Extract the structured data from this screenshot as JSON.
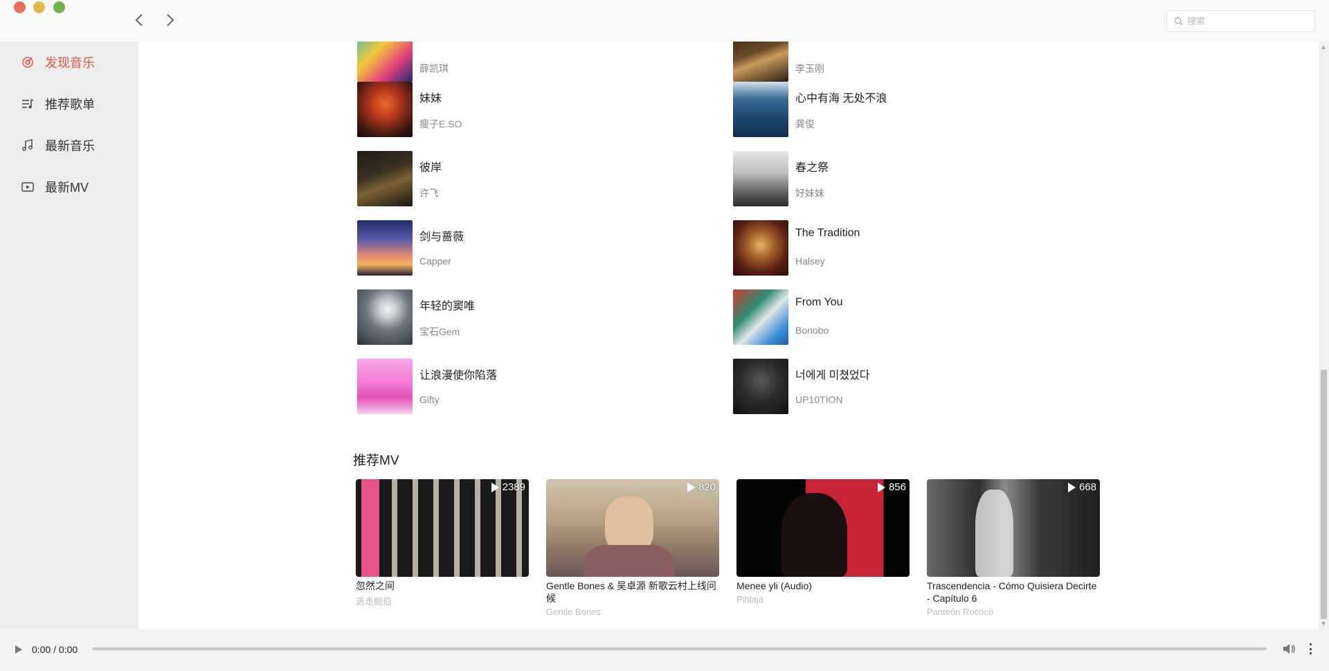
{
  "window": {
    "controls": [
      "close",
      "minimize",
      "maximize"
    ]
  },
  "header": {
    "back_icon": "chevron-left-icon",
    "forward_icon": "chevron-right-icon",
    "search_placeholder": "搜索",
    "search_value": ""
  },
  "sidebar": {
    "items": [
      {
        "label": "发现音乐",
        "icon": "target-icon",
        "active": true
      },
      {
        "label": "推荐歌单",
        "icon": "playlist-icon",
        "active": false
      },
      {
        "label": "最新音乐",
        "icon": "music-note-icon",
        "active": false
      },
      {
        "label": "最新MV",
        "icon": "video-icon",
        "active": false
      }
    ],
    "active_color": "#e0564a"
  },
  "songs": {
    "left": [
      {
        "title": "",
        "artist": "薛凯琪"
      },
      {
        "title": "妹妹",
        "artist": "瘦子E.SO"
      },
      {
        "title": "彼岸",
        "artist": "许飞"
      },
      {
        "title": "剑与蔷薇",
        "artist": "Capper"
      },
      {
        "title": "年轻的窦唯",
        "artist": "宝石Gem"
      },
      {
        "title": "让浪漫使你陷落",
        "artist": "Gifty"
      }
    ],
    "right": [
      {
        "title": "",
        "artist": "李玉刚"
      },
      {
        "title": "心中有海 无处不浪",
        "artist": "龚俊"
      },
      {
        "title": "春之祭",
        "artist": "好妹妹"
      },
      {
        "title": "The Tradition",
        "artist": "Halsey"
      },
      {
        "title": "From You",
        "artist": "Bonobo"
      },
      {
        "title": "너에게 미쳤었다",
        "artist": "UP10TION"
      }
    ]
  },
  "mv_section": {
    "title": "推荐MV",
    "items": [
      {
        "title": "忽然之间",
        "artist": "逃走鲍伯",
        "plays": "2389"
      },
      {
        "title": "Gentle Bones & 吴卓源 新歌云村上线问候",
        "artist": "Gentle Bones",
        "plays": "820"
      },
      {
        "title": "Menee yli (Audio)",
        "artist": "Pihlaja",
        "plays": "856"
      },
      {
        "title": "Trascendencia - Cómo Quisiera Decirte - Capítulo 6",
        "artist": "Panteón Rococó",
        "plays": "668"
      }
    ]
  },
  "player": {
    "time": "0:00 / 0:00",
    "progress": 0,
    "play_icon": "play-icon",
    "volume_icon": "volume-icon",
    "more_icon": "more-vertical-icon"
  }
}
